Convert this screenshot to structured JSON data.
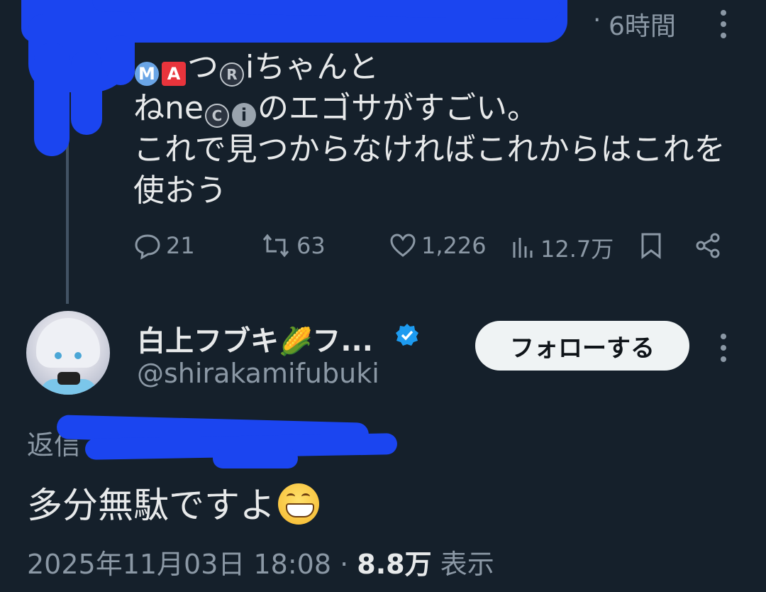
{
  "parent_tweet": {
    "truncation": "...",
    "dot": "·",
    "time": "6時間",
    "text_lines": [
      [
        "",
        "つ",
        "iちゃんと"
      ],
      [
        "ね",
        "ne",
        "",
        "",
        "のエゴサがすごい。"
      ],
      [
        "これで見つからなければこれからはこれを"
      ],
      [
        "使おう"
      ]
    ],
    "badges": {
      "m": "M",
      "a": "A",
      "r": "R",
      "c": "C",
      "i": "i"
    },
    "actions": {
      "replies": "21",
      "reposts": "63",
      "likes": "1,226",
      "views": "12.7万"
    }
  },
  "reply_tweet": {
    "author_name": "白上フブキ",
    "author_name_suffix": "フ...",
    "corn_emoji": "🌽",
    "handle": "@shirakamifubuki",
    "follow_label": "フォローする",
    "reply_to_label": "返信",
    "text": "多分無駄ですよ",
    "date": "2025年11月03日 18:08",
    "dot": "·",
    "views_count": "8.8万",
    "views_label": "表示"
  },
  "colors": {
    "background": "#15202b",
    "text": "#e7e9ea",
    "muted": "#8b98a5",
    "verified": "#1d9bf0",
    "redaction": "#1b45f0"
  }
}
